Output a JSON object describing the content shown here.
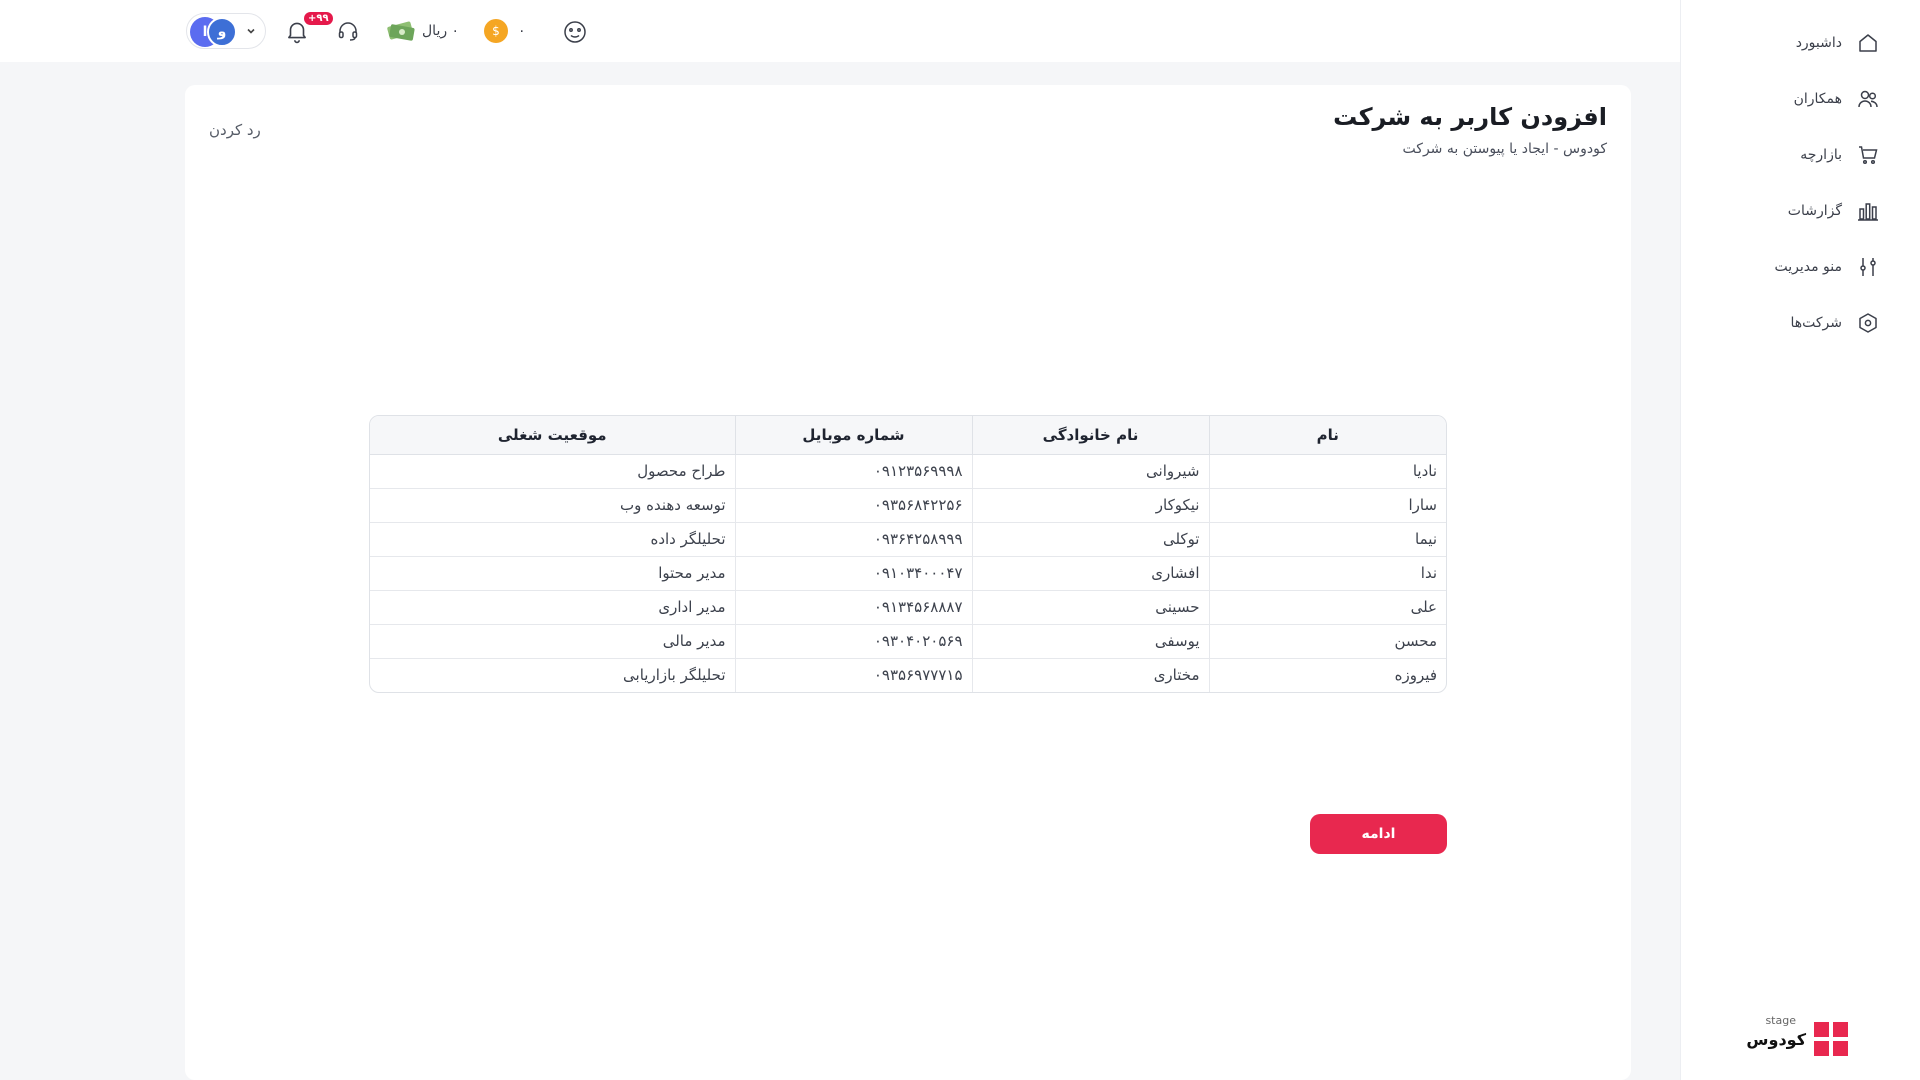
{
  "sidebar": {
    "items": [
      {
        "label": "داشبورد",
        "icon": "home-icon"
      },
      {
        "label": "همکاران",
        "icon": "users-icon"
      },
      {
        "label": "بازارچه",
        "icon": "cart-icon"
      },
      {
        "label": "گزارشات",
        "icon": "chart-bars-icon"
      },
      {
        "label": "منو مدیریت",
        "icon": "sliders-icon"
      },
      {
        "label": "شرکت‌ها",
        "icon": "hexagon-gear-icon"
      }
    ],
    "brand_name": "کودوس",
    "brand_stage": "stage"
  },
  "topbar": {
    "avatar_initials": [
      "ا",
      "و"
    ],
    "notification_count": "+۹۹",
    "wallet_label": "۰ ریال",
    "coins_value": "۰",
    "coin_symbol": "$"
  },
  "page": {
    "title": "افزودن کاربر به شرکت",
    "subtitle": "کودوس - ایجاد یا پیوستن به شرکت",
    "reject_label": "رد کردن",
    "continue_label": "ادامه"
  },
  "table": {
    "headers": [
      "نام",
      "نام خانوادگی",
      "شماره موبایل",
      "موقعیت شغلی"
    ],
    "rows": [
      [
        "نادیا",
        "شیروانی",
        "۰۹۱۲۳۵۶۹۹۹۸",
        "طراح محصول"
      ],
      [
        "سارا",
        "نیکوکار",
        "۰۹۳۵۶۸۴۲۲۵۶",
        "توسعه دهنده وب"
      ],
      [
        "نیما",
        "توکلی",
        "۰۹۳۶۴۲۵۸۹۹۹",
        "تحلیلگر داده"
      ],
      [
        "ندا",
        "افشاری",
        "۰۹۱۰۳۴۰۰۰۴۷",
        "مدیر محتوا"
      ],
      [
        "علی",
        "حسینی",
        "۰۹۱۳۴۵۶۸۸۸۷",
        "مدیر اداری"
      ],
      [
        "محسن",
        "یوسفی",
        "۰۹۳۰۴۰۲۰۵۶۹",
        "مدیر مالی"
      ],
      [
        "فیروزه",
        "مختاری",
        "۰۹۳۵۶۹۷۷۷۱۵",
        "تحلیلگر بازاریابی"
      ]
    ]
  },
  "colors": {
    "accent": "#e8284f",
    "avatar_primary": "#5b6cf0",
    "avatar_secondary": "#3d6fd6",
    "coin": "#f5a623"
  }
}
